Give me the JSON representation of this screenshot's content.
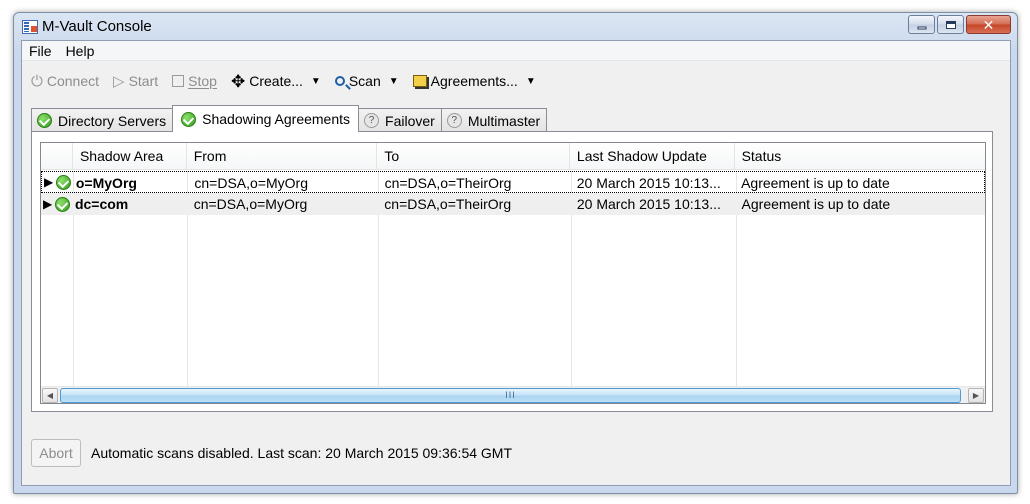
{
  "window": {
    "title": "M-Vault Console",
    "close_glyph": "✕"
  },
  "menu": [
    "File",
    "Help"
  ],
  "toolbar": {
    "connect": "Connect",
    "start": "Start",
    "stop": "Stop",
    "create": "Create...",
    "scan": "Scan",
    "agreements": "Agreements...",
    "caret": "▼"
  },
  "tabs": {
    "directory_servers": "Directory Servers",
    "shadowing_agreements": "Shadowing Agreements",
    "failover": "Failover",
    "multimaster": "Multimaster",
    "active": "Shadowing Agreements",
    "help_glyph": "?"
  },
  "table": {
    "columns": [
      "Shadow Area",
      "From",
      "To",
      "Last Shadow Update",
      "Status"
    ],
    "rows": [
      {
        "area": "o=MyOrg",
        "from": "cn=DSA,o=MyOrg",
        "to": "cn=DSA,o=TheirOrg",
        "last_update": "20 March 2015 10:13...",
        "status": "Agreement is up to date",
        "status_icon": "ok-icon",
        "expand_glyph": "▶"
      },
      {
        "area": "dc=com",
        "from": "cn=DSA,o=MyOrg",
        "to": "cn=DSA,o=TheirOrg",
        "last_update": "20 March 2015 10:13...",
        "status": "Agreement is up to date",
        "status_icon": "ok-icon",
        "expand_glyph": "▶"
      }
    ]
  },
  "scrollbar": {
    "left_glyph": "◀",
    "right_glyph": "▶",
    "grip": "III"
  },
  "status": {
    "abort_label": "Abort",
    "text": "Automatic scans disabled. Last scan: 20 March 2015 09:36:54 GMT"
  },
  "colors": {
    "ok_green": "#2f9c1a",
    "title_bar": "#cfdcee",
    "selection_border": "#000000"
  }
}
